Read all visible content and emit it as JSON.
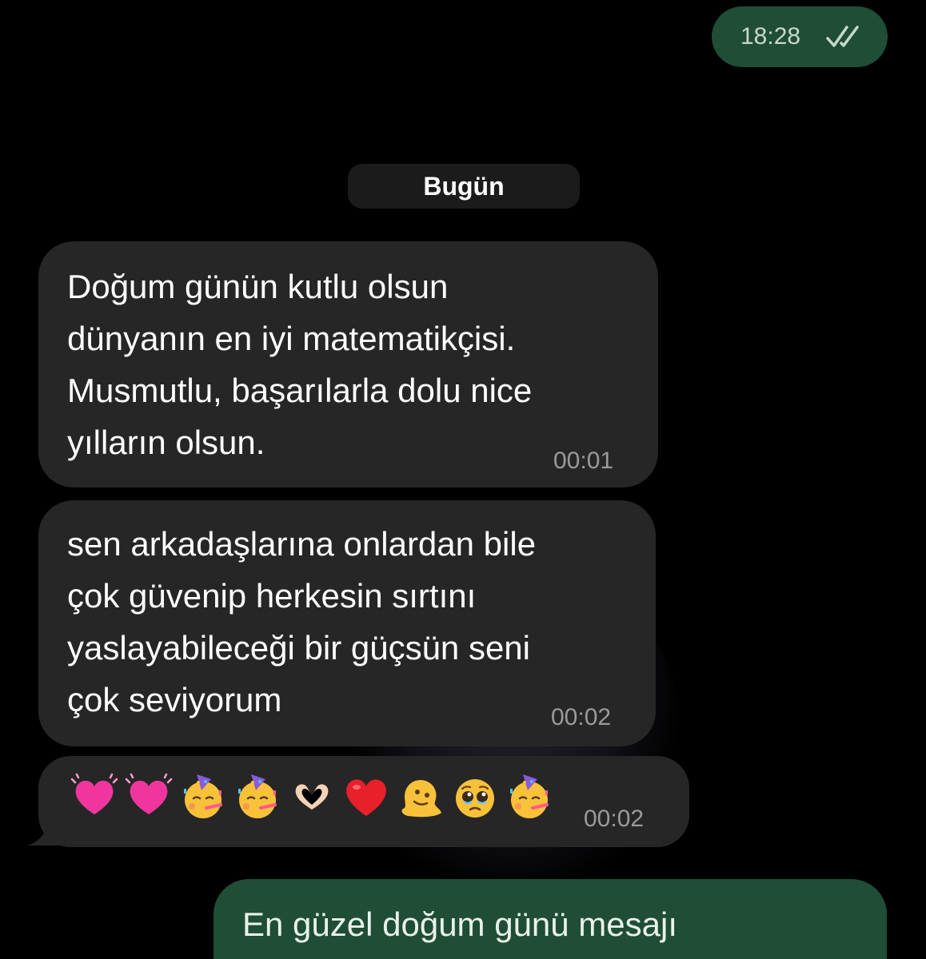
{
  "chat": {
    "top_message": {
      "time": "18:28",
      "status_icon": "double-check-icon"
    },
    "date_separator": "Bugün",
    "messages": [
      {
        "text": "Doğum günün kutlu olsun\ndünyanın en iyi matematikçisi.\nMusmutlu, başarılarla dolu nice\nyılların olsun.",
        "time": "00:01"
      },
      {
        "text": "sen arkadaşlarına onlardan bile\nçok güvenip herkesin sırtını\nyaslayabileceği bir güçsün seni\nçok seviyorum",
        "time": "00:02"
      },
      {
        "emojis": [
          "pink-heart-icon",
          "pink-heart-icon",
          "party-face-icon",
          "party-face-icon",
          "heart-hands-icon",
          "red-heart-icon",
          "melting-face-icon",
          "pleading-face-icon",
          "party-face-icon"
        ],
        "time": "00:02"
      }
    ],
    "outgoing_partial": {
      "text": "En güzel doğum günü mesajı"
    }
  },
  "colors": {
    "background": "#000000",
    "incoming_bubble": "#262626",
    "outgoing_bubble": "#1f4d35",
    "date_pill": "#1b1b1b"
  }
}
